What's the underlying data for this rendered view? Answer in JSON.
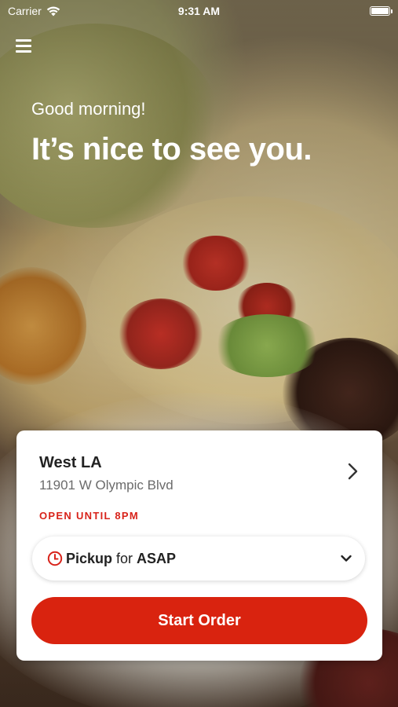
{
  "status_bar": {
    "carrier": "Carrier",
    "time": "9:31 AM"
  },
  "header": {
    "greeting": "Good morning!",
    "headline": "It’s nice to see you."
  },
  "location": {
    "name": "West LA",
    "address": "11901 W Olympic Blvd",
    "hours": "OPEN UNTIL 8PM"
  },
  "pickup": {
    "mode": "Pickup",
    "connector": " for ",
    "time": "ASAP"
  },
  "cta": {
    "label": "Start Order"
  },
  "colors": {
    "accent": "#d9230f",
    "status_red": "#d8231a"
  },
  "icons": [
    "menu-icon",
    "wifi-icon",
    "battery-icon",
    "chevron-right-icon",
    "clock-icon",
    "chevron-down-icon"
  ]
}
